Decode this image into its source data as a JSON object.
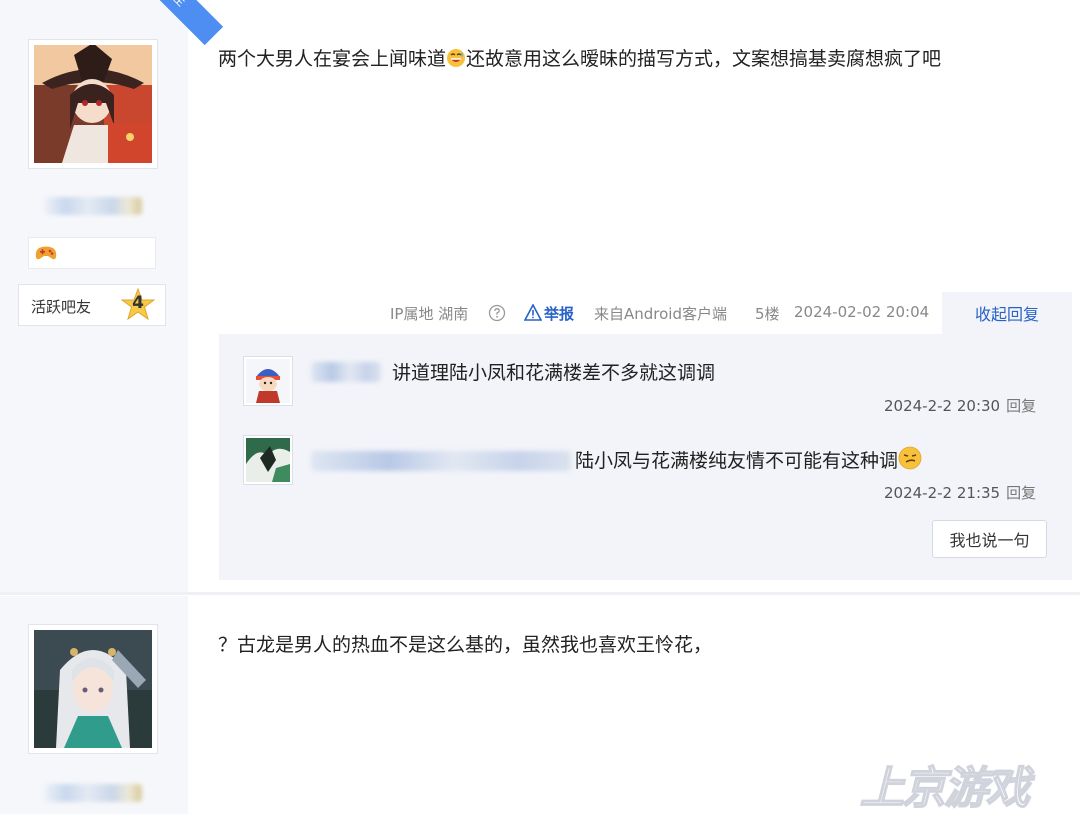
{
  "post1": {
    "ribbon": "楼主",
    "text": "两个大男人在宴会上闻味道",
    "text_after_emoji": "还故意用这么暧昧的描写方式，文案想搞基卖腐想疯了吧",
    "level_label": "活跃吧友",
    "level_number": "4",
    "meta": {
      "ip": "IP属地 湖南",
      "report": "举报",
      "client": "来自Android客户端",
      "floor": "5楼",
      "time": "2024-02-02 20:04",
      "collapse": "收起回复"
    },
    "replies": [
      {
        "text": "讲道理陆小凤和花满楼差不多就这调调",
        "time": "2024-2-2 20:30",
        "reply_label": "回复"
      },
      {
        "text": "陆小凤与花满楼纯友情不可能有这种调",
        "time": "2024-2-2 21:35",
        "reply_label": "回复"
      }
    ],
    "say_button": "我也说一句"
  },
  "post2": {
    "text": "？古龙是男人的热血不是这么基的，虽然我也喜欢王怜花，"
  },
  "icons": {
    "help": "question-circle-icon",
    "report": "warning-triangle-icon",
    "game": "gamepad-icon",
    "emoji1": "grin-sweat-emoji-icon",
    "emoji2": "smirk-emoji-icon"
  },
  "colors": {
    "link": "#2962c7",
    "ribbon": "#4e8ef2",
    "sidebar_bg": "#f6f7fa",
    "reply_bg": "#f2f4f9"
  }
}
